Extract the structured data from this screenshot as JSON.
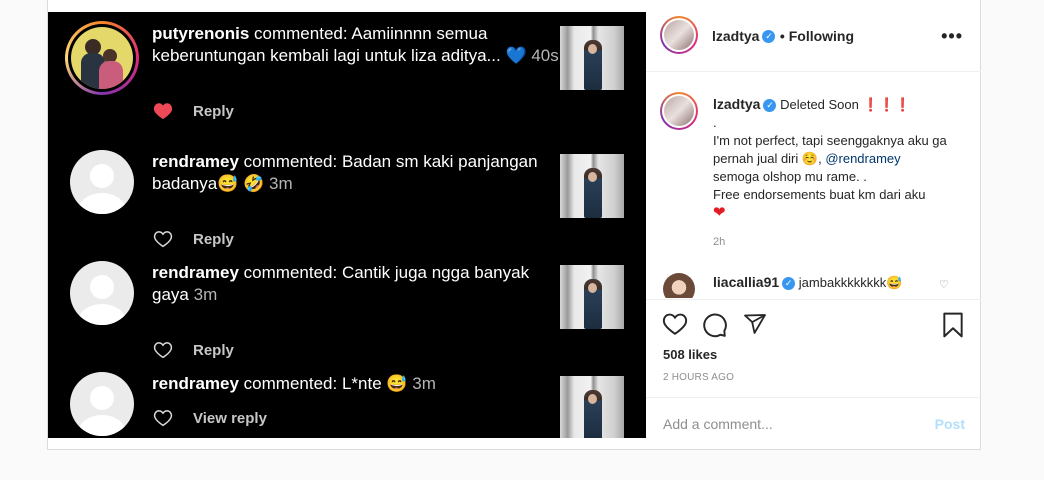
{
  "comments": [
    {
      "user": "putyrenonis",
      "verb": "commented:",
      "text": "Aamiinnnn semua keberuntungan kembali lagi untuk liza aditya... 💙",
      "time": "40s",
      "liked": true,
      "reply": "Reply"
    },
    {
      "user": "rendramey",
      "verb": "commented:",
      "text": "Badan sm kaki panjangan badanya😅 🤣",
      "time": "3m",
      "liked": false,
      "reply": "Reply"
    },
    {
      "user": "rendramey",
      "verb": "commented:",
      "text": "Cantik juga ngga banyak gaya",
      "time": "3m",
      "liked": false,
      "reply": "Reply"
    },
    {
      "user": "rendramey",
      "verb": "commented:",
      "text": "L*nte 😅",
      "time": "3m",
      "liked": false,
      "reply": "View reply"
    }
  ],
  "header": {
    "username": "lzadtya",
    "following": "• Following",
    "more": "•••"
  },
  "caption": {
    "username": "lzadtya",
    "title": "Deleted Soon ❗❗❗",
    "lines": [
      ".",
      "I'm not perfect, tapi seenggaknya aku ga pernah jual diri ☺️,"
    ],
    "mention": "@rendramey",
    "line_after": "semoga olshop mu rame. .",
    "line_last": "Free endorsements buat km dari aku",
    "heart": "❤",
    "time": "2h"
  },
  "comment2": {
    "username": "liacallia91",
    "text": "jambakkkkkkkk😅"
  },
  "likes": "508 likes",
  "posted": "2 HOURS AGO",
  "add_comment": {
    "placeholder": "Add a comment...",
    "post": "Post"
  },
  "icons": [
    "heart-icon",
    "comment-icon",
    "share-icon",
    "bookmark-icon"
  ],
  "colors": {
    "accent": "#3897f0",
    "like_red": "#ed4956",
    "post_disabled": "#b2dffc"
  }
}
